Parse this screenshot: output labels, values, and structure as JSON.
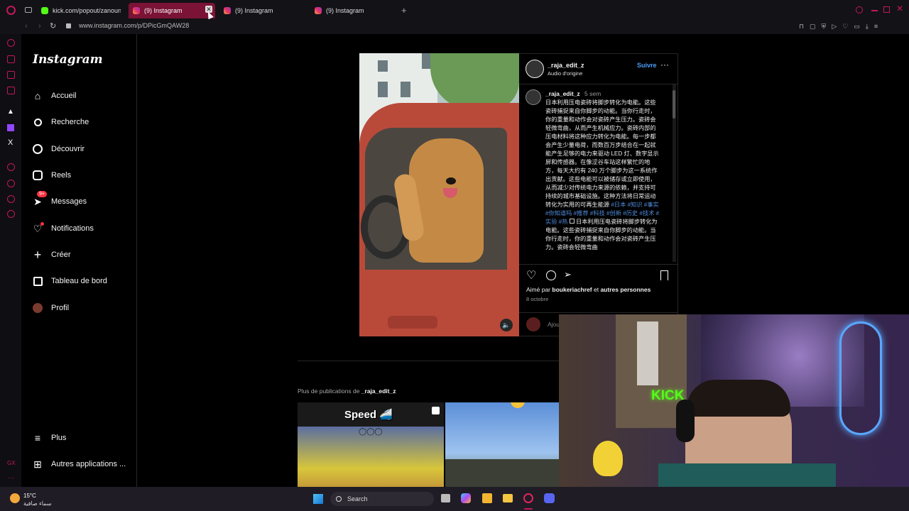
{
  "browser": {
    "tabs": [
      {
        "label": "kick.com/popout/zanoun",
        "icon": "kick-icon",
        "active": false
      },
      {
        "label": "(9) Instagram",
        "icon": "instagram-icon",
        "active": true
      },
      {
        "label": "(9) Instagram",
        "icon": "instagram-icon",
        "active": false
      },
      {
        "label": "(9) Instagram",
        "icon": "instagram-icon",
        "active": false
      }
    ],
    "url": "www.instagram.com/p/DPicGmQAW28"
  },
  "instagram": {
    "logo": "Instagram",
    "nav": [
      {
        "label": "Accueil",
        "icon": "home-icon"
      },
      {
        "label": "Recherche",
        "icon": "search-icon"
      },
      {
        "label": "Découvrir",
        "icon": "compass-icon"
      },
      {
        "label": "Reels",
        "icon": "reels-icon"
      },
      {
        "label": "Messages",
        "icon": "messenger-icon",
        "badge": "9+"
      },
      {
        "label": "Notifications",
        "icon": "heart-icon"
      },
      {
        "label": "Créer",
        "icon": "plus-icon"
      },
      {
        "label": "Tableau de bord",
        "icon": "dashboard-icon"
      },
      {
        "label": "Profil",
        "icon": "avatar-icon"
      }
    ],
    "more": "Plus",
    "other_apps": "Autres applications ..."
  },
  "post": {
    "username": "_raja_edit_z",
    "follow": "Suivre",
    "audio": "Audio d'origine",
    "caption_user": "_raja_edit_z",
    "caption_time": "5 sem",
    "caption_text": "日本利用压电瓷砖将脚步转化为电能。这些瓷砖捕捉来自你脚步的动能。当你行走时，你的重量和动作会对瓷砖产生压力。瓷砖会轻微弯曲，从而产生机械应力。瓷砖内部的压电材料将这种应力转化为电能。每一步都会产生少量电荷，而数百万步结合在一起就能产生足够的电力来驱动 LED 灯、数字显示屏和传感器。在像涩谷车站这样繁忙的地方，每天大约有 240 万个脚步为这一系统作出贡献。这些电能可以被储存或立即使用，从而减少对传统电力来源的依赖，并支持可持续的城市基础设施。这种方法将日常运动转化为实用的可再生能源",
    "caption_tags": "#日本 #知识 #事实 #你知道吗 #推荐 #科技 #创新 #历史 #技术 #实验 #热",
    "caption_repeat": "日本利用压电瓷砖将脚步转化为电能。这些瓷砖捕捉来自你脚步的动能。当你行走时，你的重量和动作会对瓷砖产生压力。瓷砖会轻微弯曲",
    "liked_by_prefix": "Aimé par",
    "liked_by_user": "boukeriachref",
    "liked_by_and": "et",
    "liked_by_others": "autres personnes",
    "date": "8 octobre",
    "comment_placeholder": "Ajouter un commentaire..."
  },
  "more_posts": {
    "prefix": "Plus de publications de",
    "user": "_raja_edit_z",
    "thumb1_text": "Speed 🚄"
  },
  "webcam": {
    "sign": "KICK"
  },
  "taskbar": {
    "temp": "15°C",
    "weather": "سماء صافية",
    "search": "Search"
  },
  "colors": {
    "accent": "#c2185b",
    "link": "#4f8bd9",
    "follow": "#4a9ff5"
  }
}
